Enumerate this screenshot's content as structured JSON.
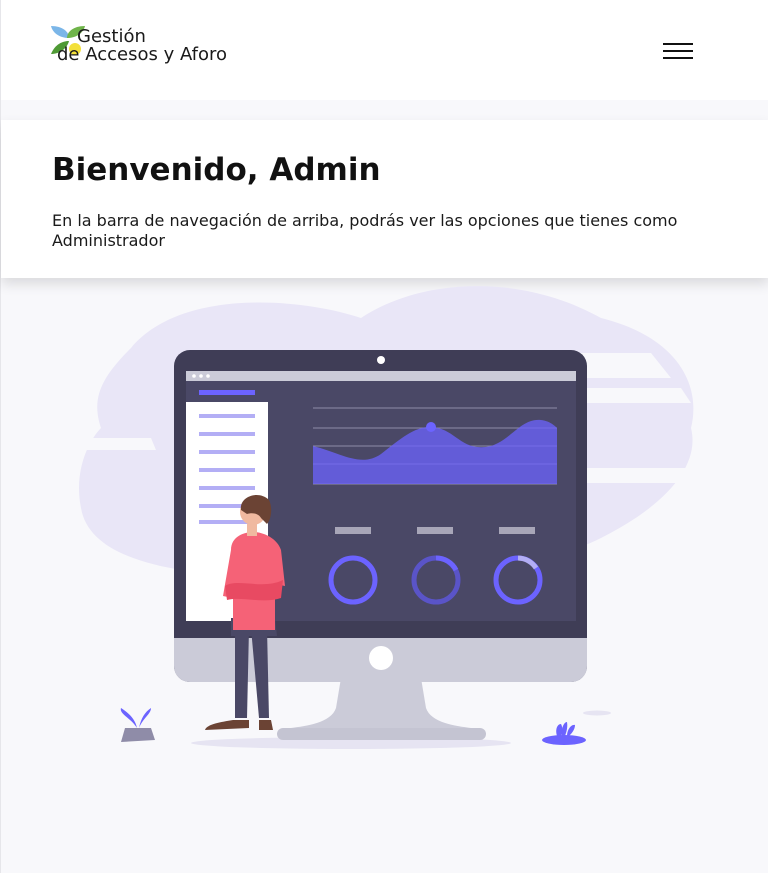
{
  "header": {
    "brand_line1": "Gestión",
    "brand_line2": "de Accesos y Aforo",
    "logo_icon": "leaf-logo-icon",
    "menu_icon": "hamburger-menu-icon"
  },
  "welcome": {
    "title": "Bienvenido, Admin",
    "text": "En la barra de navegación de arriba, podrás ver las opciones que tienes como Administrador"
  },
  "illustration": {
    "name": "dashboard-illustration",
    "accent_color": "#6c63ff",
    "screen_color": "#4a4866",
    "person_shirt_color": "#f56277"
  },
  "colors": {
    "page_background": "#f8f8fb",
    "card_background": "#ffffff",
    "text": "#111111"
  }
}
